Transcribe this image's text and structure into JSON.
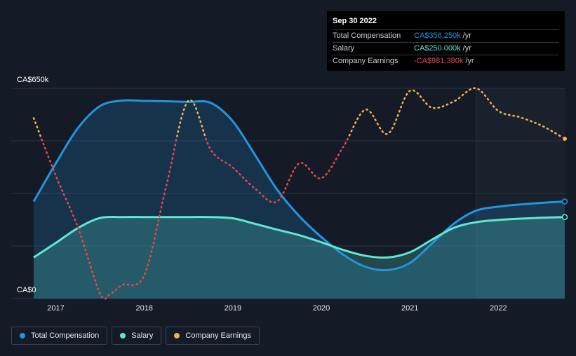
{
  "tooltip": {
    "date": "Sep 30 2022",
    "rows": [
      {
        "label": "Total Compensation",
        "value": "CA$356.250k",
        "unit": "/yr",
        "color": "#2394df"
      },
      {
        "label": "Salary",
        "value": "CA$250.000k",
        "unit": "/yr",
        "color": "#5de8d3"
      },
      {
        "label": "Company Earnings",
        "value": "-CA$981.380k",
        "unit": "/yr",
        "color": "#e0474f"
      }
    ]
  },
  "legend": [
    {
      "label": "Total Compensation",
      "color": "#2394df"
    },
    {
      "label": "Salary",
      "color": "#5de8d3"
    },
    {
      "label": "Company Earnings",
      "color": "#f2b150"
    }
  ],
  "chart_data": {
    "type": "area",
    "y_axis_labels": [
      "CA$650k",
      "CA$0"
    ],
    "ylim": [
      0,
      650
    ],
    "xlim": [
      2016.75,
      2022.75
    ],
    "x_ticks": [
      "2017",
      "2018",
      "2019",
      "2020",
      "2021",
      "2022"
    ],
    "colors": {
      "total": "#2394df",
      "salary": "#5de8d3",
      "earnings_neg": "#e0474f",
      "earnings_pos": "#f2b150"
    },
    "series": [
      {
        "name": "Total Compensation",
        "key": "total",
        "x": [
          2016.75,
          2017.0,
          2017.25,
          2017.5,
          2017.75,
          2018.0,
          2018.25,
          2018.5,
          2018.75,
          2019.0,
          2019.25,
          2019.5,
          2019.75,
          2020.0,
          2020.25,
          2020.5,
          2020.75,
          2021.0,
          2021.25,
          2021.5,
          2021.75,
          2022.0,
          2022.25,
          2022.5,
          2022.75
        ],
        "y": [
          300,
          418,
          527,
          595,
          612,
          611,
          610,
          608,
          605,
          548,
          444,
          337,
          255,
          190,
          135,
          98,
          88,
          110,
          170,
          232,
          272,
          284,
          291,
          296,
          300
        ]
      },
      {
        "name": "Salary",
        "key": "salary",
        "x": [
          2016.75,
          2017.0,
          2017.25,
          2017.5,
          2017.75,
          2018.0,
          2018.25,
          2018.5,
          2018.75,
          2019.0,
          2019.25,
          2019.5,
          2019.75,
          2020.0,
          2020.25,
          2020.5,
          2020.75,
          2021.0,
          2021.25,
          2021.5,
          2021.75,
          2022.0,
          2022.25,
          2022.5,
          2022.75
        ],
        "y": [
          127,
          172,
          218,
          249,
          252,
          252,
          252,
          252,
          252,
          248,
          231,
          213,
          196,
          174,
          150,
          132,
          127,
          143,
          182,
          219,
          236,
          243,
          247,
          250,
          252
        ]
      },
      {
        "name": "Company Earnings",
        "key": "earnings",
        "x": [
          2016.75,
          2017.0,
          2017.25,
          2017.5,
          2017.62,
          2017.75,
          2018.0,
          2018.25,
          2018.5,
          2018.75,
          2019.0,
          2019.25,
          2019.5,
          2019.75,
          2020.0,
          2020.25,
          2020.5,
          2020.75,
          2021.0,
          2021.25,
          2021.5,
          2021.75,
          2022.0,
          2022.25,
          2022.5,
          2022.75
        ],
        "y": [
          558,
          380,
          220,
          15,
          15,
          42,
          72,
          350,
          612,
          460,
          405,
          340,
          300,
          418,
          372,
          470,
          584,
          509,
          642,
          590,
          610,
          650,
          580,
          560,
          533,
          494
        ]
      }
    ]
  }
}
